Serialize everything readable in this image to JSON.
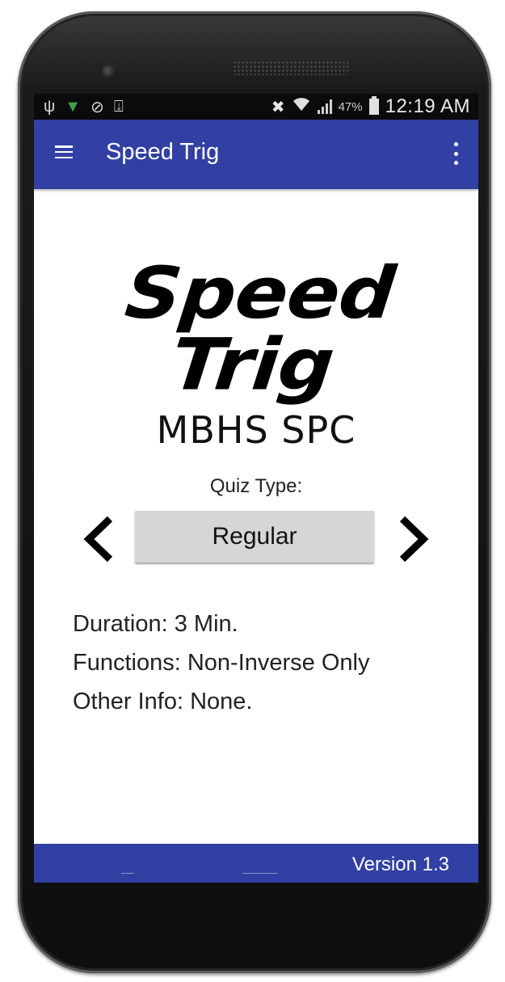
{
  "status_bar": {
    "battery_percent": "47%",
    "time": "12:19 AM",
    "icons": [
      "usb-icon",
      "wifi-notification-icon",
      "sync-icon",
      "download-icon",
      "mute-icon",
      "wifi-icon",
      "signal-icon",
      "battery-charging-icon"
    ]
  },
  "app_bar": {
    "title": "Speed Trig",
    "menu_icon": "hamburger-menu-icon",
    "overflow_icon": "more-vert-icon"
  },
  "logo": {
    "title": "Speed Trig",
    "subtitle": "MBHS SPC"
  },
  "quiz": {
    "label": "Quiz Type:",
    "selected": "Regular",
    "prev_icon": "chevron-left-icon",
    "next_icon": "chevron-right-icon"
  },
  "info": {
    "duration": "Duration: 3 Min.",
    "functions": "Functions: Non-Inverse Only",
    "other": "Other Info: None."
  },
  "footer": {
    "version": "Version 1.3"
  },
  "colors": {
    "primary": "#3140a2",
    "status_bar": "#0b0b0b",
    "selector_bg": "#d6d6d6"
  }
}
